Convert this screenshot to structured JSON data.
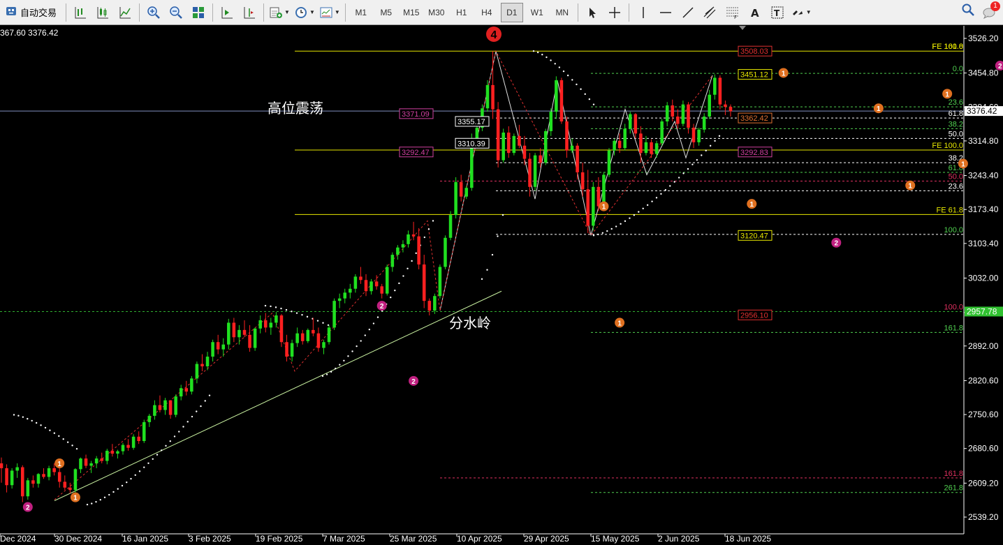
{
  "toolbar": {
    "autotrade_label": "自动交易",
    "timeframes": [
      "M1",
      "M5",
      "M15",
      "M30",
      "H1",
      "H4",
      "D1",
      "W1",
      "MN"
    ],
    "active_timeframe": "D1",
    "notification_count": "1"
  },
  "chart": {
    "ohlc_text": "367.60 3376.42",
    "current_price_tag": "3376.42",
    "green_price_tag": "2957.78",
    "text_annotations": [
      "高位震荡",
      "分水岭"
    ],
    "wave_big_label": "4"
  },
  "chart_data": {
    "type": "candlestick",
    "timeframe": "D1",
    "y_ticks": [
      "3526.20",
      "3454.80",
      "3384.60",
      "3314.80",
      "3243.40",
      "3173.40",
      "3103.40",
      "3032.00",
      "2961.00",
      "2892.00",
      "2820.60",
      "2750.60",
      "2680.60",
      "2609.20",
      "2539.20"
    ],
    "x_ticks": [
      "Dec 2024",
      "30 Dec 2024",
      "16 Jan 2025",
      "3 Feb 2025",
      "19 Feb 2025",
      "7 Mar 2025",
      "25 Mar 2025",
      "10 Apr 2025",
      "29 Apr 2025",
      "15 May 2025",
      "2 Jun 2025",
      "18 Jun 2025"
    ],
    "price_boxes": [
      {
        "text": "3508.03",
        "price": 3500,
        "color": "#e03030"
      },
      {
        "text": "3451.12",
        "price": 3452,
        "color": "#e8e800"
      },
      {
        "text": "3371.09",
        "price": 3371,
        "color": "#d040a0"
      },
      {
        "text": "3362.42",
        "price": 3362,
        "color": "#e07030"
      },
      {
        "text": "3355.17",
        "price": 3355,
        "color": "#ffffff"
      },
      {
        "text": "3310.39",
        "price": 3310,
        "color": "#ffffff"
      },
      {
        "text": "3292.47",
        "price": 3292,
        "color": "#d040a0"
      },
      {
        "text": "3292.83",
        "price": 3292,
        "color": "#d040a0"
      },
      {
        "text": "3120.47",
        "price": 3120,
        "color": "#e8e800"
      },
      {
        "text": "2956.10",
        "price": 2956,
        "color": "#e03030"
      }
    ],
    "fib_labels": [
      {
        "text": "FE 161.8",
        "price": 3500,
        "color": "#e8e800"
      },
      {
        "text": "FE 100.0",
        "price": 3500,
        "color": "#e8e800"
      },
      {
        "text": "0.0",
        "price": 3454,
        "color": "#50d050"
      },
      {
        "text": "23.6",
        "price": 3385,
        "color": "#50d050"
      },
      {
        "text": "61.8",
        "price": 3362,
        "color": "#ffffff"
      },
      {
        "text": "38.2",
        "price": 3340,
        "color": "#50d050"
      },
      {
        "text": "50.0",
        "price": 3320,
        "color": "#ffffff"
      },
      {
        "text": "FE 100.0",
        "price": 3296,
        "color": "#e8e800"
      },
      {
        "text": "38.2",
        "price": 3270,
        "color": "#ffffff"
      },
      {
        "text": "61.8",
        "price": 3250,
        "color": "#50d050"
      },
      {
        "text": "50.0",
        "price": 3232,
        "color": "#e03060"
      },
      {
        "text": "23.6",
        "price": 3212,
        "color": "#ffffff"
      },
      {
        "text": "FE 61.8",
        "price": 3163,
        "color": "#e8e800"
      },
      {
        "text": "100.0",
        "price": 3122,
        "color": "#50d050"
      },
      {
        "text": "100.0",
        "price": 2963,
        "color": "#e03060"
      },
      {
        "text": "161.8",
        "price": 2920,
        "color": "#50d050"
      },
      {
        "text": "161.8",
        "price": 2620,
        "color": "#e03060"
      },
      {
        "text": "261.8",
        "price": 2590,
        "color": "#50d050"
      }
    ],
    "wave_labels": [
      {
        "text": "2",
        "date_index": 5,
        "price": 2560,
        "color": "#c02080"
      },
      {
        "text": "1",
        "date_index": 11,
        "price": 2650,
        "color": "#e07020"
      },
      {
        "text": "1",
        "date_index": 14,
        "price": 2580,
        "color": "#e07020"
      },
      {
        "text": "2",
        "date_index": 72,
        "price": 2975,
        "color": "#c02080"
      },
      {
        "text": "2",
        "date_index": 78,
        "price": 2820,
        "color": "#c02080"
      },
      {
        "text": "1",
        "date_index": 114,
        "price": 3180,
        "color": "#e07020"
      },
      {
        "text": "1",
        "date_index": 117,
        "price": 2940,
        "color": "#e07020"
      },
      {
        "text": "1",
        "date_index": 148,
        "price": 3455,
        "color": "#e07020"
      },
      {
        "text": "1",
        "date_index": 142,
        "price": 3185,
        "color": "#e07020"
      },
      {
        "text": "2",
        "date_index": 158,
        "price": 3105,
        "color": "#c02080"
      },
      {
        "text": "1",
        "date_index": 166,
        "price": 3382,
        "color": "#e07020"
      },
      {
        "text": "1",
        "date_index": 172,
        "price": 3223,
        "color": "#e07020"
      },
      {
        "text": "1",
        "date_index": 179,
        "price": 3412,
        "color": "#e07020"
      },
      {
        "text": "1",
        "date_index": 182,
        "price": 3268,
        "color": "#e07020"
      },
      {
        "text": "2",
        "date_index": 189,
        "price": 3470,
        "color": "#c02080"
      }
    ],
    "candles": [
      [
        2650,
        2662,
        2610,
        2640
      ],
      [
        2640,
        2648,
        2590,
        2605
      ],
      [
        2605,
        2640,
        2598,
        2635
      ],
      [
        2635,
        2650,
        2620,
        2642
      ],
      [
        2642,
        2646,
        2570,
        2582
      ],
      [
        2582,
        2620,
        2575,
        2615
      ],
      [
        2615,
        2625,
        2600,
        2608
      ],
      [
        2608,
        2630,
        2600,
        2628
      ],
      [
        2628,
        2640,
        2618,
        2622
      ],
      [
        2622,
        2645,
        2615,
        2640
      ],
      [
        2640,
        2650,
        2625,
        2632
      ],
      [
        2632,
        2640,
        2600,
        2612
      ],
      [
        2612,
        2625,
        2595,
        2600
      ],
      [
        2600,
        2610,
        2588,
        2595
      ],
      [
        2595,
        2640,
        2590,
        2638
      ],
      [
        2638,
        2662,
        2630,
        2660
      ],
      [
        2660,
        2668,
        2640,
        2645
      ],
      [
        2645,
        2655,
        2630,
        2650
      ],
      [
        2650,
        2665,
        2640,
        2660
      ],
      [
        2660,
        2672,
        2650,
        2655
      ],
      [
        2655,
        2680,
        2648,
        2676
      ],
      [
        2676,
        2690,
        2664,
        2670
      ],
      [
        2670,
        2678,
        2660,
        2675
      ],
      [
        2675,
        2692,
        2668,
        2688
      ],
      [
        2688,
        2700,
        2676,
        2682
      ],
      [
        2682,
        2710,
        2678,
        2705
      ],
      [
        2705,
        2716,
        2690,
        2696
      ],
      [
        2696,
        2740,
        2692,
        2735
      ],
      [
        2735,
        2752,
        2725,
        2748
      ],
      [
        2748,
        2780,
        2740,
        2770
      ],
      [
        2770,
        2790,
        2755,
        2760
      ],
      [
        2760,
        2785,
        2750,
        2780
      ],
      [
        2780,
        2772,
        2742,
        2750
      ],
      [
        2750,
        2792,
        2745,
        2788
      ],
      [
        2788,
        2812,
        2780,
        2805
      ],
      [
        2805,
        2820,
        2790,
        2798
      ],
      [
        2798,
        2830,
        2792,
        2825
      ],
      [
        2825,
        2860,
        2815,
        2855
      ],
      [
        2855,
        2875,
        2840,
        2850
      ],
      [
        2850,
        2880,
        2842,
        2870
      ],
      [
        2870,
        2905,
        2860,
        2900
      ],
      [
        2900,
        2915,
        2875,
        2885
      ],
      [
        2885,
        2908,
        2870,
        2895
      ],
      [
        2895,
        2948,
        2885,
        2940
      ],
      [
        2940,
        2950,
        2900,
        2910
      ],
      [
        2910,
        2935,
        2895,
        2925
      ],
      [
        2925,
        2945,
        2910,
        2915
      ],
      [
        2915,
        2935,
        2880,
        2888
      ],
      [
        2888,
        2930,
        2882,
        2928
      ],
      [
        2928,
        2955,
        2918,
        2945
      ],
      [
        2945,
        2960,
        2920,
        2930
      ],
      [
        2930,
        2950,
        2915,
        2940
      ],
      [
        2940,
        2962,
        2930,
        2955
      ],
      [
        2955,
        2958,
        2890,
        2900
      ],
      [
        2900,
        2915,
        2860,
        2870
      ],
      [
        2870,
        2905,
        2860,
        2898
      ],
      [
        2898,
        2930,
        2890,
        2918
      ],
      [
        2918,
        2925,
        2895,
        2902
      ],
      [
        2902,
        2928,
        2898,
        2925
      ],
      [
        2925,
        2950,
        2912,
        2918
      ],
      [
        2918,
        2930,
        2880,
        2888
      ],
      [
        2888,
        2905,
        2875,
        2900
      ],
      [
        2900,
        2935,
        2895,
        2930
      ],
      [
        2930,
        2990,
        2925,
        2985
      ],
      [
        2985,
        3000,
        2970,
        2990
      ],
      [
        2990,
        3010,
        2980,
        3002
      ],
      [
        3002,
        3020,
        2990,
        3010
      ],
      [
        3010,
        3040,
        3002,
        3035
      ],
      [
        3035,
        3055,
        3020,
        3028
      ],
      [
        3028,
        3040,
        2995,
        3005
      ],
      [
        3005,
        3030,
        2998,
        3025
      ],
      [
        3025,
        3038,
        3008,
        3015
      ],
      [
        3015,
        3020,
        2990,
        3000
      ],
      [
        3000,
        3060,
        2996,
        3055
      ],
      [
        3055,
        3085,
        3045,
        3080
      ],
      [
        3080,
        3100,
        3070,
        3095
      ],
      [
        3095,
        3110,
        3085,
        3102
      ],
      [
        3102,
        3130,
        3095,
        3122
      ],
      [
        3122,
        3148,
        3110,
        3118
      ],
      [
        3118,
        3135,
        3050,
        3060
      ],
      [
        3060,
        3080,
        2970,
        2985
      ],
      [
        2985,
        2990,
        2955,
        2965
      ],
      [
        2965,
        3000,
        2958,
        2995
      ],
      [
        2995,
        3060,
        2990,
        3055
      ],
      [
        3055,
        3120,
        3050,
        3115
      ],
      [
        3115,
        3170,
        3110,
        3162
      ],
      [
        3162,
        3240,
        3155,
        3230
      ],
      [
        3230,
        3245,
        3190,
        3200
      ],
      [
        3200,
        3222,
        3195,
        3218
      ],
      [
        3218,
        3330,
        3212,
        3320
      ],
      [
        3320,
        3350,
        3310,
        3342
      ],
      [
        3342,
        3390,
        3335,
        3382
      ],
      [
        3382,
        3440,
        3375,
        3430
      ],
      [
        3430,
        3500,
        3360,
        3380
      ],
      [
        3380,
        3395,
        3260,
        3275
      ],
      [
        3275,
        3340,
        3270,
        3332
      ],
      [
        3332,
        3345,
        3280,
        3290
      ],
      [
        3290,
        3330,
        3285,
        3325
      ],
      [
        3325,
        3348,
        3300,
        3305
      ],
      [
        3305,
        3325,
        3265,
        3278
      ],
      [
        3278,
        3290,
        3200,
        3220
      ],
      [
        3220,
        3290,
        3212,
        3285
      ],
      [
        3285,
        3300,
        3260,
        3270
      ],
      [
        3270,
        3340,
        3265,
        3335
      ],
      [
        3335,
        3382,
        3325,
        3375
      ],
      [
        3375,
        3448,
        3360,
        3440
      ],
      [
        3440,
        3445,
        3350,
        3355
      ],
      [
        3355,
        3365,
        3280,
        3295
      ],
      [
        3295,
        3320,
        3290,
        3305
      ],
      [
        3305,
        3310,
        3235,
        3250
      ],
      [
        3250,
        3270,
        3200,
        3215
      ],
      [
        3215,
        3255,
        3125,
        3140
      ],
      [
        3140,
        3230,
        3130,
        3220
      ],
      [
        3220,
        3240,
        3170,
        3180
      ],
      [
        3180,
        3250,
        3175,
        3245
      ],
      [
        3245,
        3300,
        3240,
        3295
      ],
      [
        3295,
        3320,
        3285,
        3315
      ],
      [
        3315,
        3330,
        3290,
        3300
      ],
      [
        3300,
        3350,
        3295,
        3340
      ],
      [
        3340,
        3375,
        3330,
        3370
      ],
      [
        3370,
        3372,
        3320,
        3330
      ],
      [
        3330,
        3345,
        3270,
        3290
      ],
      [
        3290,
        3325,
        3285,
        3312
      ],
      [
        3312,
        3318,
        3280,
        3288
      ],
      [
        3288,
        3315,
        3280,
        3310
      ],
      [
        3310,
        3360,
        3305,
        3355
      ],
      [
        3355,
        3395,
        3345,
        3388
      ],
      [
        3388,
        3400,
        3355,
        3365
      ],
      [
        3365,
        3380,
        3340,
        3350
      ],
      [
        3350,
        3398,
        3345,
        3390
      ],
      [
        3390,
        3395,
        3330,
        3342
      ],
      [
        3342,
        3350,
        3300,
        3312
      ],
      [
        3312,
        3342,
        3305,
        3338
      ],
      [
        3338,
        3372,
        3332,
        3365
      ],
      [
        3365,
        3420,
        3360,
        3410
      ],
      [
        3410,
        3452,
        3400,
        3445
      ],
      [
        3445,
        3450,
        3380,
        3390
      ],
      [
        3390,
        3398,
        3368,
        3385
      ],
      [
        3385,
        3390,
        3365,
        3376
      ]
    ],
    "candles_start_index": 0
  }
}
